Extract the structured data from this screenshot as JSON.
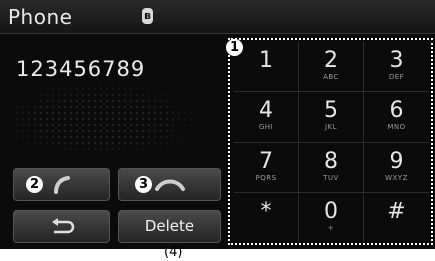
{
  "header": {
    "title": "Phone",
    "bluetooth_icon": "bluetooth-icon"
  },
  "display": {
    "number": "123456789"
  },
  "buttons": {
    "call_icon": "call-icon",
    "end_call_icon": "end-call-icon",
    "back_icon": "back-icon",
    "delete_label": "Delete"
  },
  "keypad": {
    "keys": [
      {
        "digit": "1",
        "letters": ""
      },
      {
        "digit": "2",
        "letters": "ABC"
      },
      {
        "digit": "3",
        "letters": "DEF"
      },
      {
        "digit": "4",
        "letters": "GHI"
      },
      {
        "digit": "5",
        "letters": "JKL"
      },
      {
        "digit": "6",
        "letters": "MNO"
      },
      {
        "digit": "7",
        "letters": "PQRS"
      },
      {
        "digit": "8",
        "letters": "TUV"
      },
      {
        "digit": "9",
        "letters": "WXYZ"
      },
      {
        "digit": "*",
        "letters": ""
      },
      {
        "digit": "0",
        "letters": "+"
      },
      {
        "digit": "#",
        "letters": ""
      }
    ]
  },
  "callouts": {
    "keypad": "1",
    "call": "2",
    "end_call": "3",
    "delete": "(4)"
  }
}
